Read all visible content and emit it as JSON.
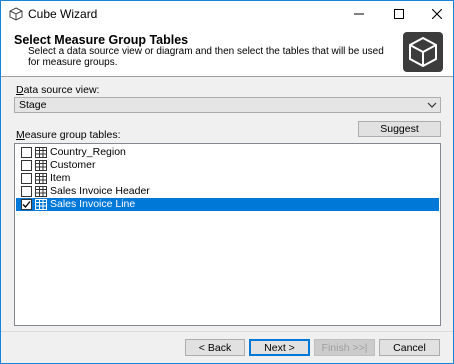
{
  "window": {
    "title": "Cube Wizard"
  },
  "header": {
    "title": "Select Measure Group Tables",
    "description": "Select a data source view or diagram and then select the tables that will be used for measure groups."
  },
  "data_source_view": {
    "label_mnemonic": "D",
    "label_rest": "ata source view:",
    "selected": "Stage"
  },
  "measure_group_tables": {
    "label_mnemonic": "M",
    "label_rest": "easure group tables:",
    "items": [
      {
        "label": "Country_Region",
        "checked": false,
        "selected": false
      },
      {
        "label": "Customer",
        "checked": false,
        "selected": false
      },
      {
        "label": "Item",
        "checked": false,
        "selected": false
      },
      {
        "label": "Sales Invoice Header",
        "checked": false,
        "selected": false
      },
      {
        "label": "Sales Invoice Line",
        "checked": true,
        "selected": true
      }
    ]
  },
  "buttons": {
    "suggest": "Suggest",
    "back": "< Back",
    "next": "Next >",
    "finish": "Finish >>|",
    "cancel": "Cancel"
  },
  "colors": {
    "selection": "#0078d7",
    "accent_border": "#1883d7"
  }
}
